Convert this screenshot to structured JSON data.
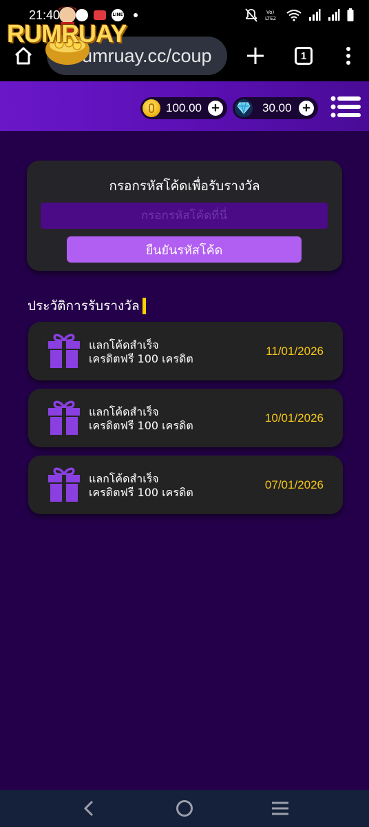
{
  "status_bar": {
    "time": "21:40u.",
    "icons": [
      "chat-bubble-icon",
      "shopee-icon",
      "line-icon",
      "dot-icon",
      "mute-icon",
      "volte-icon",
      "wifi-icon",
      "signal-icon",
      "signal-icon",
      "battery-icon"
    ],
    "volte_label": "Vo) LTE2"
  },
  "browser": {
    "url": "rumruay.cc/coup",
    "tab_count": "1"
  },
  "header": {
    "logo_text": "RUMRUAY",
    "coins": "100.00",
    "gems": "30.00"
  },
  "redeem": {
    "title": "กรอกรหัสโค้ดเพื่อรับรางวัล",
    "input_placeholder": "กรอกรหัสโค้ดที่นี่",
    "input_value": "",
    "confirm_label": "ยืนยันรหัสโค้ด"
  },
  "history": {
    "heading": "ประวัติการรับรางวัล",
    "items": [
      {
        "title": "แลกโค้ดสำเร็จ",
        "subtitle": "เครดิตฟรี 100 เครดิต",
        "date": "11/01/2026",
        "icon": "gift-icon"
      },
      {
        "title": "แลกโค้ดสำเร็จ",
        "subtitle": "เครดิตฟรี 100 เครดิต",
        "date": "10/01/2026",
        "icon": "gift-icon"
      },
      {
        "title": "แลกโค้ดสำเร็จ",
        "subtitle": "เครดิตฟรี 100 เครดิต",
        "date": "07/01/2026",
        "icon": "gift-icon"
      }
    ]
  },
  "colors": {
    "page_bg": "#24004a",
    "header_bg": "#6a17c9",
    "card_bg": "#252428",
    "input_bg": "#4b0a86",
    "button_bg": "#b15ef2",
    "date_color": "#f4c518",
    "gift_color": "#8a3fe0",
    "nav_bar_bg": "#15203a"
  }
}
